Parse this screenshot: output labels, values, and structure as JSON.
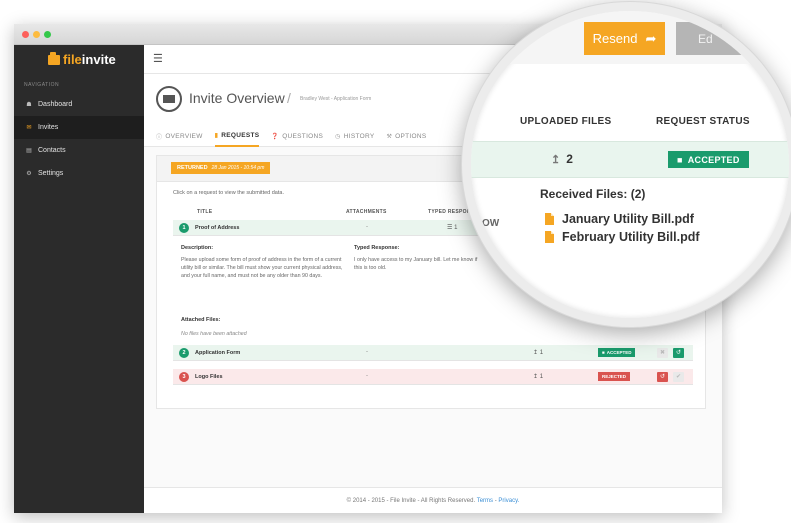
{
  "app": {
    "logo": {
      "accent": "file",
      "rest": "invite"
    },
    "nav_caption": "NAVIGATION",
    "nav": [
      {
        "label": "Dashboard",
        "icon": "home-icon"
      },
      {
        "label": "Invites",
        "icon": "envelope-icon"
      },
      {
        "label": "Contacts",
        "icon": "contacts-icon"
      },
      {
        "label": "Settings",
        "icon": "gear-icon"
      }
    ],
    "active_nav": "Invites"
  },
  "header": {
    "title": "Invite Overview",
    "separator": "/",
    "breadcrumb": "Bradley West - Application Form",
    "tabs": [
      {
        "label": "OVERVIEW",
        "icon": "info-icon"
      },
      {
        "label": "REQUESTS",
        "icon": "document-icon"
      },
      {
        "label": "QUESTIONS",
        "icon": "question-icon"
      },
      {
        "label": "HISTORY",
        "icon": "clock-icon"
      },
      {
        "label": "OPTIONS",
        "icon": "wrench-icon"
      }
    ],
    "active_tab": "REQUESTS"
  },
  "panel": {
    "status_label": "RETURNED",
    "status_date": "28 Jan 2015 - 10:54 pm",
    "hint": "Click on a request to view the submitted data.",
    "columns": {
      "title": "TITLE",
      "attachments": "ATTACHMENTS",
      "typed": "TYPED RESPONSE"
    },
    "rows": [
      {
        "num": "1",
        "title": "Proof of Address",
        "attachments": "-",
        "typed": "1",
        "state": "expanded"
      },
      {
        "num": "2",
        "title": "Application Form",
        "attachments": "-",
        "uploaded": "1",
        "status": "ACCEPTED"
      },
      {
        "num": "3",
        "title": "Logo Files",
        "attachments": "-",
        "uploaded": "1",
        "status": "REJECTED"
      }
    ],
    "detail": {
      "description_label": "Description:",
      "description": "Please upload some form of proof of address in the form of a current utility bill or similar. The bill must show your current physical address, and your full name, and must not be any older than 90 days.",
      "typed_label": "Typed Response:",
      "typed": "I only have access to my January bill. Let me know if this is too old.",
      "attached_label": "Attached Files:",
      "attached_none": "No files have been attached"
    }
  },
  "footer": {
    "copyright": "© 2014 - 2015 - File Invite - All Rights Reserved.",
    "terms": "Terms",
    "separator": "-",
    "privacy": "Privacy."
  },
  "magnifier": {
    "resend_label": "Resend",
    "edit_label": "Ed",
    "col_uploaded": "UPLOADED FILES",
    "col_status": "REQUEST STATUS",
    "uploaded_count": "2",
    "status": "ACCEPTED",
    "received_label": "Received Files: (2)",
    "files": [
      "January Utility Bill.pdf",
      "February Utility Bill.pdf"
    ],
    "partial_text": "OW"
  },
  "colors": {
    "accent": "#f5a623",
    "success": "#1a9b6c",
    "danger": "#d9534f",
    "sidebar": "#2b2b2b"
  }
}
